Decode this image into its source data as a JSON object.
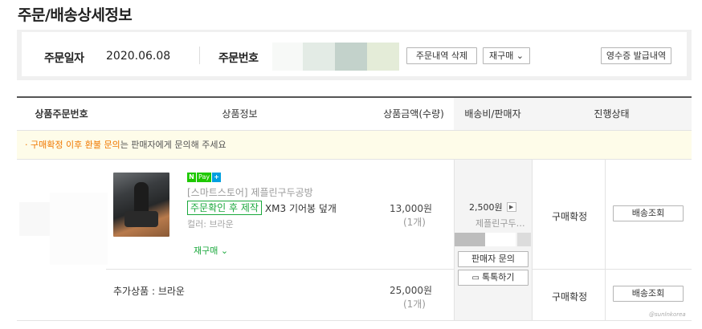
{
  "page_title": "주문/배송상세정보",
  "summary": {
    "order_date_label": "주문일자",
    "order_date": "2020.06.08",
    "order_no_label": "주문번호",
    "delete_btn": "주문내역 삭제",
    "rebuy_btn": "재구매 ⌄",
    "receipt_btn": "영수증 발급내역"
  },
  "table": {
    "headers": [
      "상품주문번호",
      "상품정보",
      "상품금액(수량)",
      "배송비/판매자",
      "진행상태"
    ]
  },
  "notice": {
    "highlight": "· 구매확정 이후 환불 문의",
    "text": "는 판매자에게 문의해 주세요"
  },
  "item": {
    "npay": {
      "n": "N",
      "pay": "Pay",
      "plus": "+"
    },
    "store": "[스마트스토어] 제플린구두공방",
    "tag": "주문확인 후 제작",
    "name": "XM3 기어봉 덮개",
    "option": "컬러: 브라운",
    "rebuy": "재구매 ⌄",
    "price": "13,000원",
    "qty": "(1개)",
    "status": "구매확정",
    "track_btn": "배송조회"
  },
  "shipping": {
    "fee": "2,500원",
    "fee_arrow": "▶",
    "seller": "제플린구두…",
    "inquiry_btn": "판매자 문의",
    "talk_btn": "톡톡하기",
    "talk_icon": "▭"
  },
  "extra": {
    "label": "추가상품 : 브라운",
    "price": "25,000원",
    "qty": "(1개)",
    "status": "구매확정",
    "track_btn": "배송조회"
  },
  "watermark": "@sunlnkorea",
  "colors": {
    "accent_green": "#1aa83c",
    "notice_orange": "#f07800",
    "notice_bg": "#fefce9"
  }
}
